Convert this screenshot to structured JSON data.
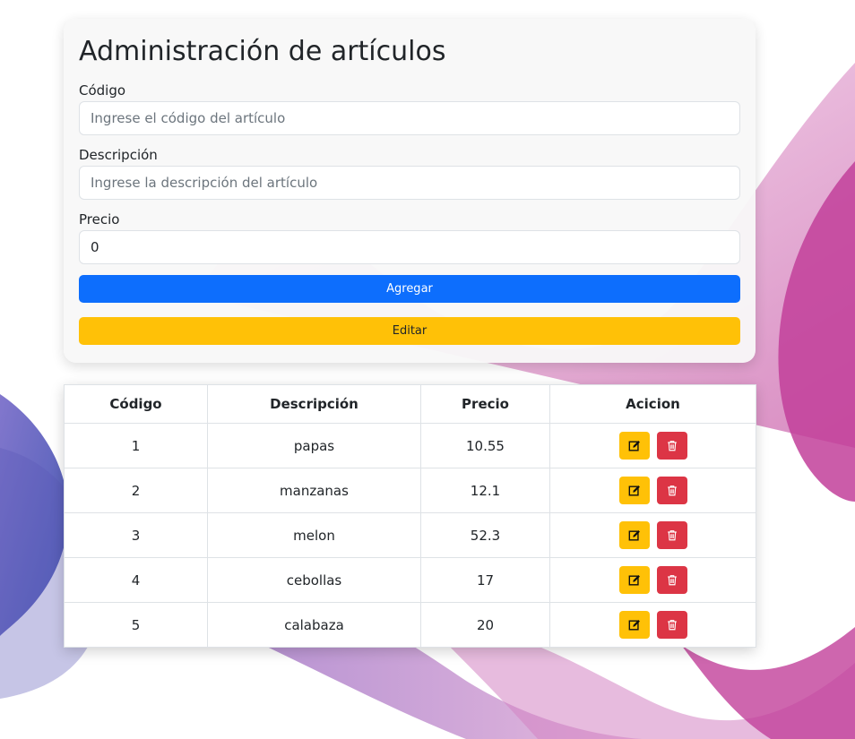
{
  "form": {
    "title": "Administración de artículos",
    "codigo_label": "Código",
    "codigo_placeholder": "Ingrese el código del artículo",
    "descripcion_label": "Descripción",
    "descripcion_placeholder": "Ingrese la descripción del artículo",
    "precio_label": "Precio",
    "precio_value": "0",
    "agregar_label": "Agregar",
    "editar_label": "Editar"
  },
  "table": {
    "headers": [
      "Código",
      "Descripción",
      "Precio",
      "Acicion"
    ],
    "rows": [
      {
        "codigo": "1",
        "descripcion": "papas",
        "precio": "10.55"
      },
      {
        "codigo": "2",
        "descripcion": "manzanas",
        "precio": "12.1"
      },
      {
        "codigo": "3",
        "descripcion": "melon",
        "precio": "52.3"
      },
      {
        "codigo": "4",
        "descripcion": "cebollas",
        "precio": "17"
      },
      {
        "codigo": "5",
        "descripcion": "calabaza",
        "precio": "20"
      }
    ],
    "action_icons": [
      "edit-icon",
      "trash-icon"
    ]
  },
  "colors": {
    "primary": "#0d6efd",
    "warning": "#ffc107",
    "danger": "#dc3545",
    "background_wave_pink": "#c2409a",
    "background_wave_blue": "#3a4db0"
  }
}
